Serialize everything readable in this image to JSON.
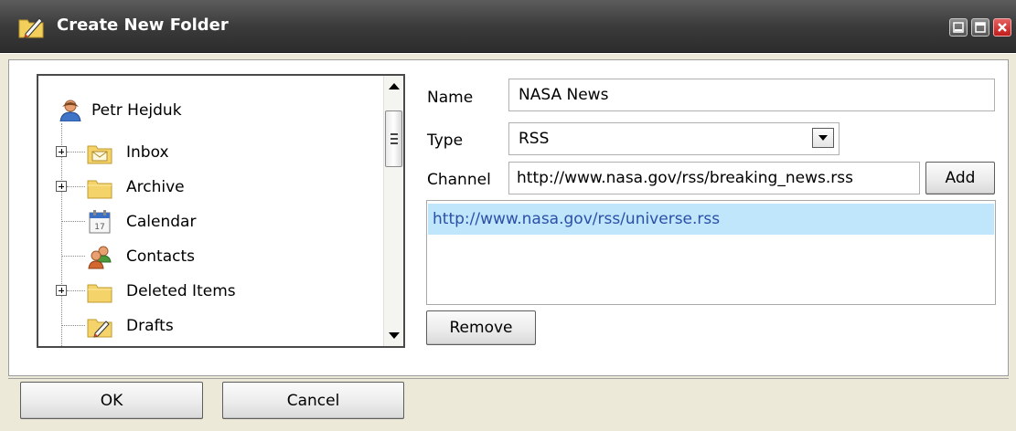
{
  "window": {
    "title": "Create New Folder",
    "controls": [
      "minimize",
      "maximize",
      "close"
    ]
  },
  "tree": {
    "root": {
      "label": "Petr Hejduk",
      "icon": "user-icon"
    },
    "items": [
      {
        "label": "Inbox",
        "icon": "inbox-folder-icon",
        "expandable": true
      },
      {
        "label": "Archive",
        "icon": "folder-icon",
        "expandable": true
      },
      {
        "label": "Calendar",
        "icon": "calendar-icon",
        "expandable": false
      },
      {
        "label": "Contacts",
        "icon": "contacts-icon",
        "expandable": false
      },
      {
        "label": "Deleted Items",
        "icon": "folder-icon",
        "expandable": true
      },
      {
        "label": "Drafts",
        "icon": "drafts-folder-icon",
        "expandable": false
      }
    ]
  },
  "form": {
    "name_label": "Name",
    "name_value": "NASA News",
    "type_label": "Type",
    "type_value": "RSS",
    "channel_label": "Channel",
    "channel_value": "http://www.nasa.gov/rss/breaking_news.rss",
    "add_label": "Add",
    "channels": [
      "http://www.nasa.gov/rss/universe.rss"
    ],
    "remove_label": "Remove"
  },
  "footer": {
    "ok_label": "OK",
    "cancel_label": "Cancel"
  },
  "colors": {
    "titlebar": "#3b3b3b",
    "dialog_background": "#ece9d8",
    "selection": "#bfe6fa",
    "link_text": "#2c4fa8"
  }
}
